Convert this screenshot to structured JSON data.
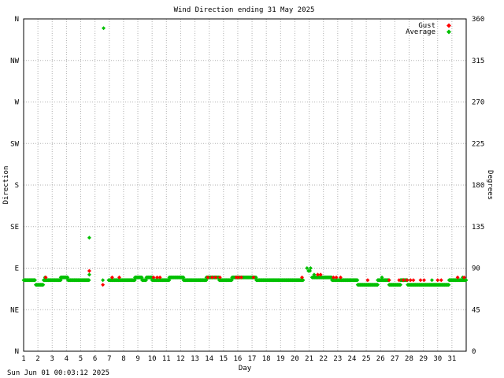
{
  "chart_data": {
    "type": "scatter",
    "title": "Wind Direction ending 31 May 2025",
    "xlabel": "Day",
    "ylabel_left": "Direction",
    "ylabel_right": "Degrees",
    "timestamp": "Sun Jun 01 00:03:12 2025",
    "xlim": [
      1,
      32
    ],
    "ylim": [
      0,
      360
    ],
    "grid": true,
    "legend_position": "top-right",
    "x_ticks": [
      "1",
      "2",
      "3",
      "4",
      "5",
      "6",
      "7",
      "8",
      "9",
      "10",
      "11",
      "12",
      "13",
      "14",
      "15",
      "16",
      "17",
      "18",
      "19",
      "20",
      "21",
      "22",
      "23",
      "24",
      "25",
      "26",
      "27",
      "28",
      "29",
      "30",
      "31"
    ],
    "left_ticks": [
      {
        "value": 0,
        "label": "N"
      },
      {
        "value": 45,
        "label": "NE"
      },
      {
        "value": 90,
        "label": "E"
      },
      {
        "value": 135,
        "label": "SE"
      },
      {
        "value": 180,
        "label": "S"
      },
      {
        "value": 225,
        "label": "SW"
      },
      {
        "value": 270,
        "label": "W"
      },
      {
        "value": 315,
        "label": "NW"
      },
      {
        "value": 360,
        "label": "N"
      }
    ],
    "right_ticks": [
      "0",
      "45",
      "90",
      "135",
      "180",
      "225",
      "270",
      "315",
      "360"
    ],
    "series": [
      {
        "name": "Gust",
        "color": "#ff0000",
        "points": [
          [
            2.55,
            80
          ],
          [
            5.6,
            87
          ],
          [
            6.55,
            72
          ],
          [
            7.2,
            80
          ],
          [
            7.7,
            80
          ],
          [
            10.1,
            80
          ],
          [
            10.35,
            80
          ],
          [
            10.55,
            80
          ],
          [
            13.9,
            80
          ],
          [
            14.2,
            80
          ],
          [
            14.45,
            80
          ],
          [
            14.75,
            80
          ],
          [
            15.9,
            80
          ],
          [
            16.05,
            80
          ],
          [
            16.25,
            80
          ],
          [
            17.1,
            80
          ],
          [
            20.5,
            80
          ],
          [
            21.6,
            83
          ],
          [
            21.8,
            83
          ],
          [
            22.7,
            80
          ],
          [
            22.9,
            80
          ],
          [
            23.2,
            80
          ],
          [
            25.1,
            77
          ],
          [
            26.6,
            77
          ],
          [
            27.3,
            77
          ],
          [
            27.6,
            77
          ],
          [
            27.85,
            77
          ],
          [
            28.1,
            77
          ],
          [
            28.3,
            77
          ],
          [
            28.8,
            77
          ],
          [
            29.05,
            77
          ],
          [
            30,
            77
          ],
          [
            30.25,
            77
          ],
          [
            31.4,
            80
          ],
          [
            31.85,
            80
          ]
        ]
      },
      {
        "name": "Average",
        "color": "#00c000",
        "points": []
      }
    ]
  }
}
